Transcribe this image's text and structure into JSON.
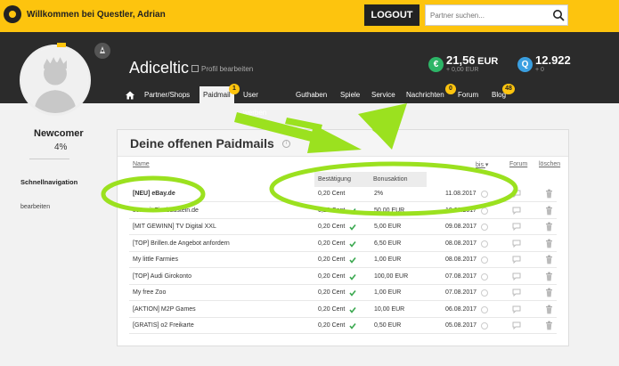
{
  "header": {
    "welcome": "Willkommen bei Questler, Adrian",
    "logout_label": "LOGOUT",
    "search_placeholder": "Partner suchen..."
  },
  "profile": {
    "username": "Adiceltic",
    "edit_label": "Profil bearbeiten",
    "level": "Newcomer",
    "progress": "4%"
  },
  "balances": {
    "eur_value": "21,56",
    "eur_unit": "EUR",
    "eur_sub": "+ 0,00 EUR",
    "points_value": "12.922",
    "points_sub": "+ 0"
  },
  "nav": {
    "items": [
      {
        "label": "Partner/Shops"
      },
      {
        "label": "Paidmail",
        "badge": "1"
      },
      {
        "label": "User werben"
      },
      {
        "label": "Guthaben"
      },
      {
        "label": "Spiele"
      },
      {
        "label": "Service"
      },
      {
        "label": "Nachrichten",
        "badge": "0"
      },
      {
        "label": "Forum"
      },
      {
        "label": "Blog",
        "badge": "48"
      }
    ]
  },
  "sidebar": {
    "quicknav_label": "Schnellnavigation",
    "edit_link": "bearbeiten"
  },
  "paidmails": {
    "title": "Deine offenen Paidmails",
    "columns": {
      "name": "Name",
      "valid": "bis",
      "forum": "Forum",
      "delete": "löschen",
      "confirm": "Bestätigung",
      "bonus": "Bonusaktion"
    },
    "rows": [
      {
        "name": "[NEU] eBay.de",
        "confirm": "0,20 Cent",
        "bonus": "2%",
        "date": "11.08.2017",
        "bold": true,
        "checked": false
      },
      {
        "name": "sen mit Zinsbaustein.de",
        "confirm": "0,20 Cent",
        "bonus": "50,00 EUR",
        "date": "10.08.2017",
        "bold": false,
        "checked": true
      },
      {
        "name": "[MIT GEWINN] TV Digital XXL",
        "confirm": "0,20 Cent",
        "bonus": "5,00 EUR",
        "date": "09.08.2017",
        "bold": false,
        "checked": true
      },
      {
        "name": "[TOP] Brillen.de Angebot anfordern",
        "confirm": "0,20 Cent",
        "bonus": "6,50 EUR",
        "date": "08.08.2017",
        "bold": false,
        "checked": true
      },
      {
        "name": "My little Farmies",
        "confirm": "0,20 Cent",
        "bonus": "1,00 EUR",
        "date": "08.08.2017",
        "bold": false,
        "checked": true
      },
      {
        "name": "[TOP] Audi Girokonto",
        "confirm": "0,20 Cent",
        "bonus": "100,00 EUR",
        "date": "07.08.2017",
        "bold": false,
        "checked": true
      },
      {
        "name": "My free Zoo",
        "confirm": "0,20 Cent",
        "bonus": "1,00 EUR",
        "date": "07.08.2017",
        "bold": false,
        "checked": true
      },
      {
        "name": "[AKTION] M2P Games",
        "confirm": "0,20 Cent",
        "bonus": "10,00 EUR",
        "date": "06.08.2017",
        "bold": false,
        "checked": true
      },
      {
        "name": "[GRATIS] o2 Freikarte",
        "confirm": "0,20 Cent",
        "bonus": "0,50 EUR",
        "date": "05.08.2017",
        "bold": false,
        "checked": true
      }
    ]
  },
  "colors": {
    "brand_yellow": "#fdc40e",
    "dark_header": "#2b2b2b",
    "eur_green": "#2db567",
    "points_blue": "#3a9fe0",
    "check_green": "#3aa84f",
    "annotation_green": "#9be11f"
  },
  "icons": [
    "logo-icon",
    "search-icon",
    "rocket-icon",
    "home-icon",
    "edit-icon",
    "euro-icon",
    "questler-points-icon",
    "info-icon",
    "check-icon",
    "clock-icon",
    "forum-icon",
    "trash-icon",
    "arrow-annotation",
    "ellipse-annotation"
  ]
}
